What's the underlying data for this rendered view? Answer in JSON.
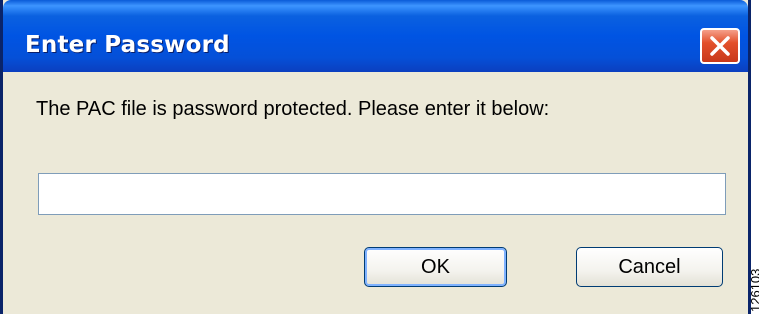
{
  "dialog": {
    "title": "Enter Password",
    "message": "The PAC file is password protected. Please enter it below:",
    "password_value": "",
    "ok_label": "OK",
    "cancel_label": "Cancel"
  },
  "figure_id": "126103",
  "icons": {
    "close": "close-icon"
  },
  "colors": {
    "titlebar": "#0054e3",
    "dialog_bg": "#ece9d8",
    "close_button": "#e3502a",
    "input_border": "#7f9db9"
  }
}
